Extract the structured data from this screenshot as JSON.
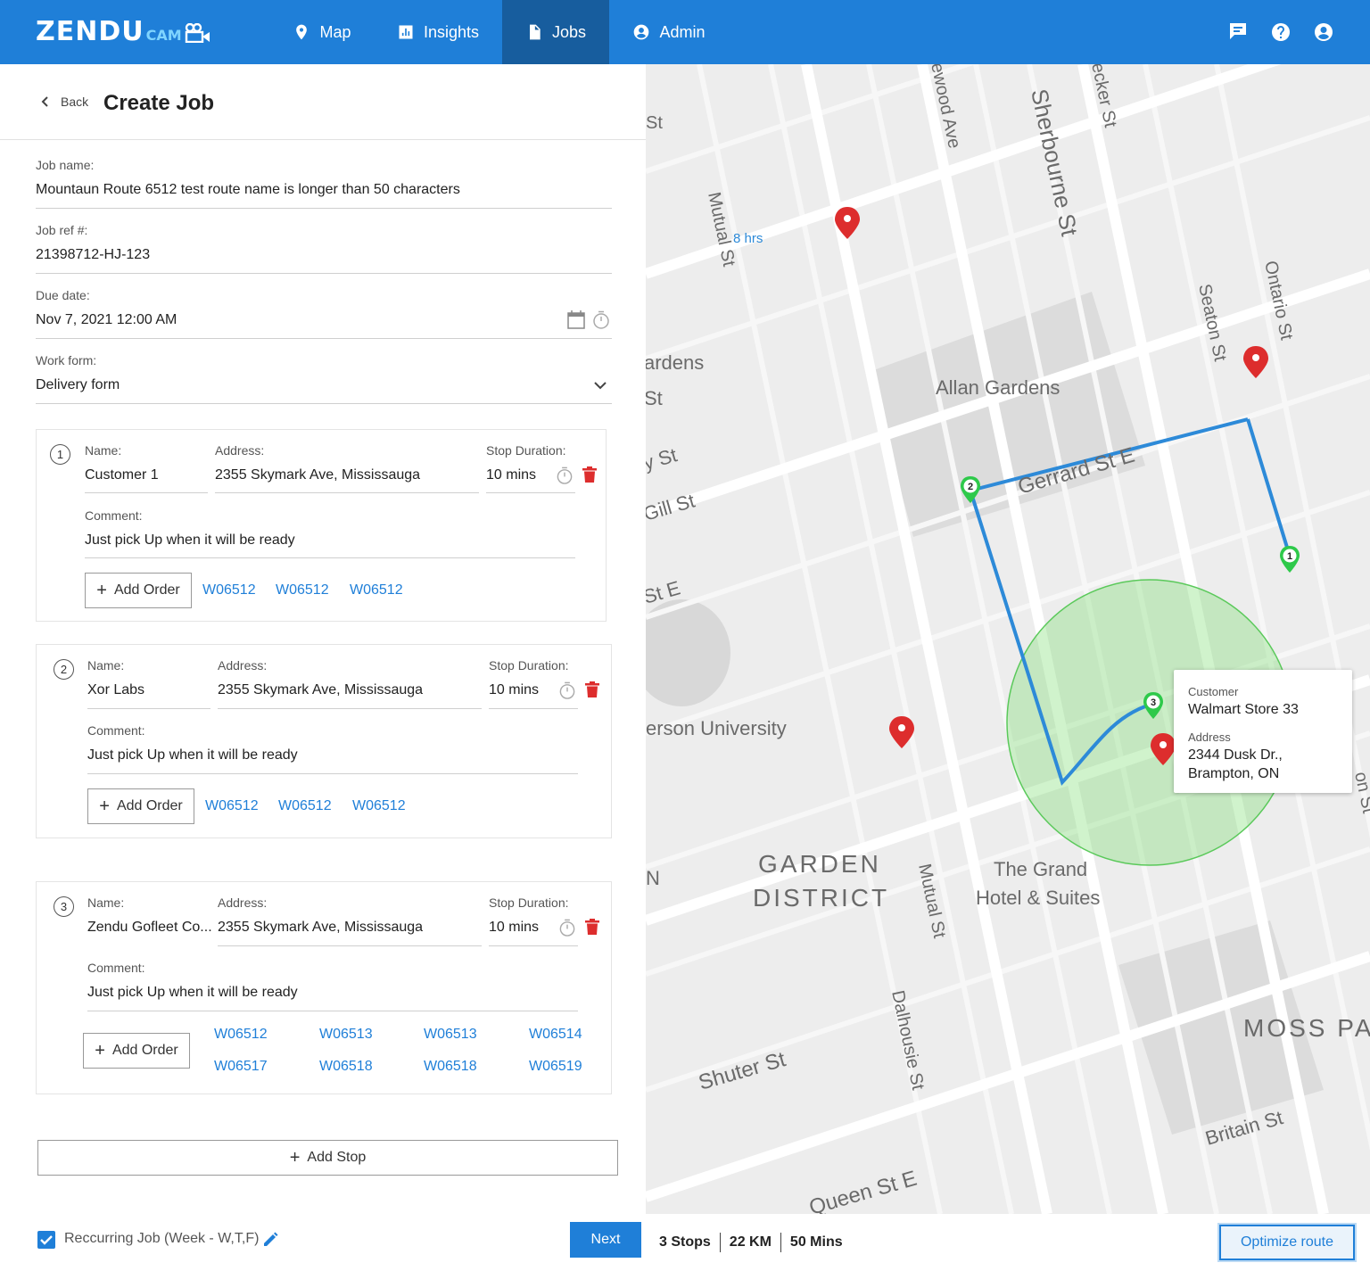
{
  "nav": {
    "logo_main": "ZENDU",
    "logo_sub": "CAM",
    "items": [
      {
        "label": "Map",
        "icon": "map-pin-icon"
      },
      {
        "label": "Insights",
        "icon": "bar-chart-icon"
      },
      {
        "label": "Jobs",
        "icon": "document-icon",
        "active": true
      },
      {
        "label": "Admin",
        "icon": "account-circle-icon"
      }
    ],
    "right_icons": [
      "flag-icon",
      "help-icon",
      "user-icon"
    ]
  },
  "header": {
    "back_label": "Back",
    "title": "Create Job"
  },
  "form": {
    "job_name_label": "Job name:",
    "job_name_value": "Mountaun Route 6512 test route name is longer than 50 characters",
    "job_ref_label": "Job ref #:",
    "job_ref_value": "21398712-HJ-123",
    "due_date_label": "Due date:",
    "due_date_value": "Nov 7, 2021 12:00 AM",
    "work_form_label": "Work form:",
    "work_form_value": "Delivery form"
  },
  "stop_labels": {
    "name": "Name:",
    "address": "Address:",
    "duration": "Stop Duration:",
    "comment": "Comment:",
    "add_order": "Add Order"
  },
  "stops": [
    {
      "number": "1",
      "name": "Customer 1",
      "address": "2355 Skymark Ave, Mississauga",
      "duration": "10 mins",
      "comment": "Just pick Up when it will be ready",
      "orders": [
        "W06512",
        "W06512",
        "W06512"
      ]
    },
    {
      "number": "2",
      "name": "Xor Labs",
      "address": "2355 Skymark Ave, Mississauga",
      "duration": "10 mins",
      "comment": "Just pick Up when it will be ready",
      "orders": [
        "W06512",
        "W06512",
        "W06512"
      ]
    },
    {
      "number": "3",
      "name": "Zendu Gofleet Co...",
      "address": "2355 Skymark Ave, Mississauga",
      "duration": "10 mins",
      "comment": "Just pick Up when it will be ready",
      "orders": [
        "W06512",
        "W06513",
        "W06513",
        "W06514",
        "W06517",
        "W06518",
        "W06518",
        "W06519"
      ]
    }
  ],
  "add_stop_label": "Add Stop",
  "recurring": {
    "checked": true,
    "label": "Reccurring Job (Week - W,T,F)"
  },
  "next_label": "Next",
  "map": {
    "street_labels": [
      "Mutual St",
      "8 hrs",
      "ewood Ave",
      "Sherbourne St",
      "ecker St",
      "Seaton St",
      "Ontario St",
      "ardens",
      "St",
      "Allan Gardens",
      "y St",
      "Gerrard St E",
      "Gill St",
      "St E",
      "erson University",
      "GARDEN",
      "DISTRICT",
      "Mutual St",
      "The Grand",
      "Hotel & Suites",
      "N",
      "MOSS PA",
      "Shuter St",
      "Dalhousie St",
      "Britain St",
      "Queen St E",
      "on St"
    ],
    "route_color": "#2d8ad8",
    "stop_pin_color": "#2ec94a",
    "red_pin_color": "#dd2d2d",
    "route_pins": [
      "1",
      "2",
      "3"
    ],
    "popup": {
      "customer_label": "Customer",
      "customer_value": "Walmart Store 33",
      "address_label": "Address",
      "address_value": "2344 Dusk Dr., Brampton, ON"
    }
  },
  "stats": {
    "stops": "3 Stops",
    "distance": "22 KM",
    "time": "50 Mins"
  },
  "optimize_label": "Optimize route"
}
